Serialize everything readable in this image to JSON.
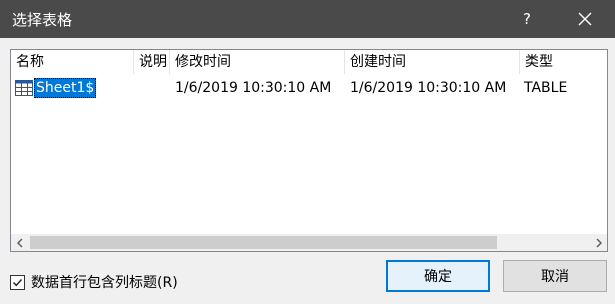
{
  "window": {
    "title": "选择表格",
    "help_label": "?",
    "close_icon": "close-icon"
  },
  "table": {
    "columns": [
      "名称",
      "说明",
      "修改时间",
      "创建时间",
      "类型"
    ],
    "rows": [
      {
        "name": "Sheet1$",
        "description": "",
        "modified": "1/6/2019 10:30:10 AM",
        "created": "1/6/2019 10:30:10 AM",
        "type": "TABLE",
        "icon": "table-icon",
        "selected": true
      }
    ]
  },
  "scrollbar": {
    "left_arrow": "left-arrow-icon",
    "right_arrow": "right-arrow-icon"
  },
  "footer": {
    "checkbox_label": "数据首行包含列标题(R)",
    "checkbox_checked": true,
    "ok_label": "确定",
    "cancel_label": "取消"
  },
  "colors": {
    "titlebar": "#4a4a4a",
    "selection": "#0078d7"
  }
}
